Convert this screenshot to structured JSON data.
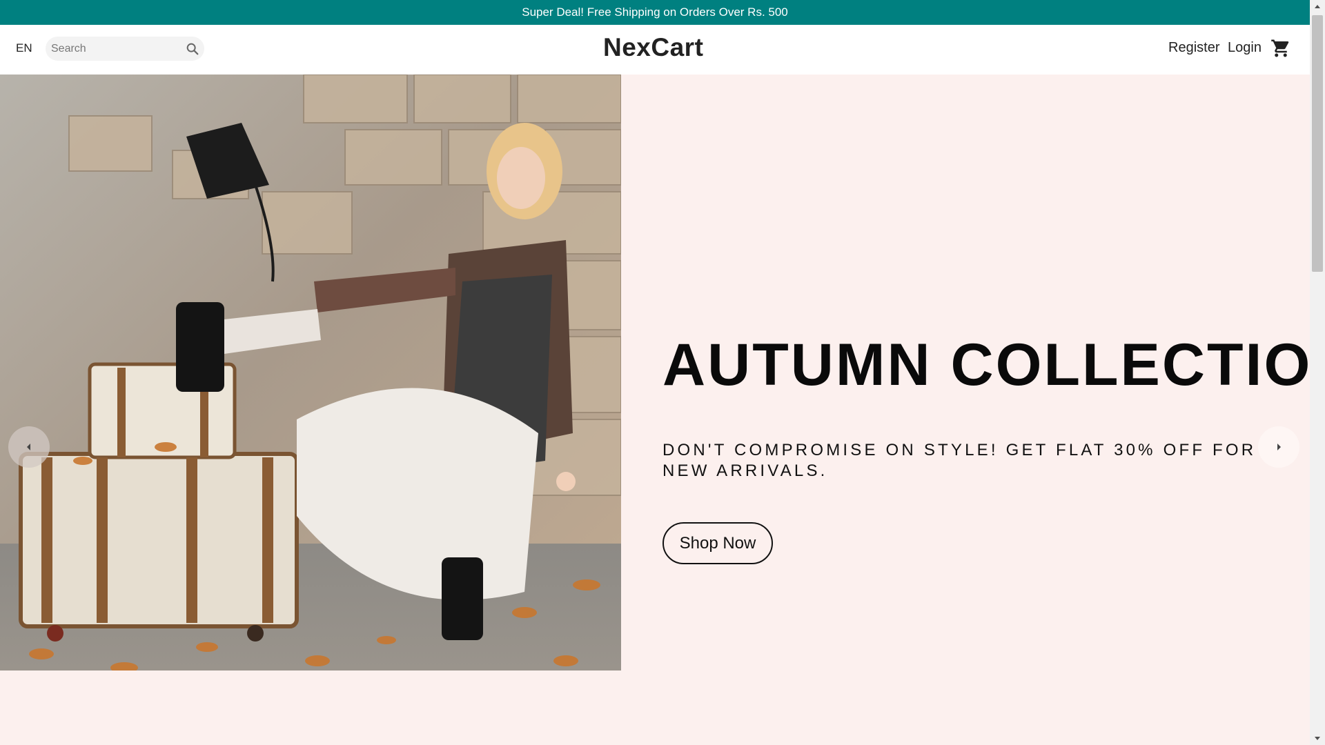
{
  "announcement": {
    "text": "Super Deal! Free Shipping on Orders Over Rs. 500"
  },
  "header": {
    "language": "EN",
    "search_placeholder": "Search",
    "logo": "NexCart",
    "register_label": "Register",
    "login_label": "Login",
    "icons": {
      "search": "search-icon",
      "cart": "cart-icon"
    }
  },
  "hero": {
    "title": "AUTUMN COLLECTION",
    "subtitle": "DON'T COMPROMISE ON STYLE! GET FLAT 30% OFF FOR NEW ARRIVALS.",
    "button_label": "Shop Now",
    "background_color": "#fcf0ee",
    "slider_icons": {
      "prev": "chevron-left-icon",
      "next": "chevron-right-icon"
    }
  },
  "colors": {
    "announcement_bg": "#008080",
    "header_bg": "#ffffff",
    "text": "#111111"
  }
}
